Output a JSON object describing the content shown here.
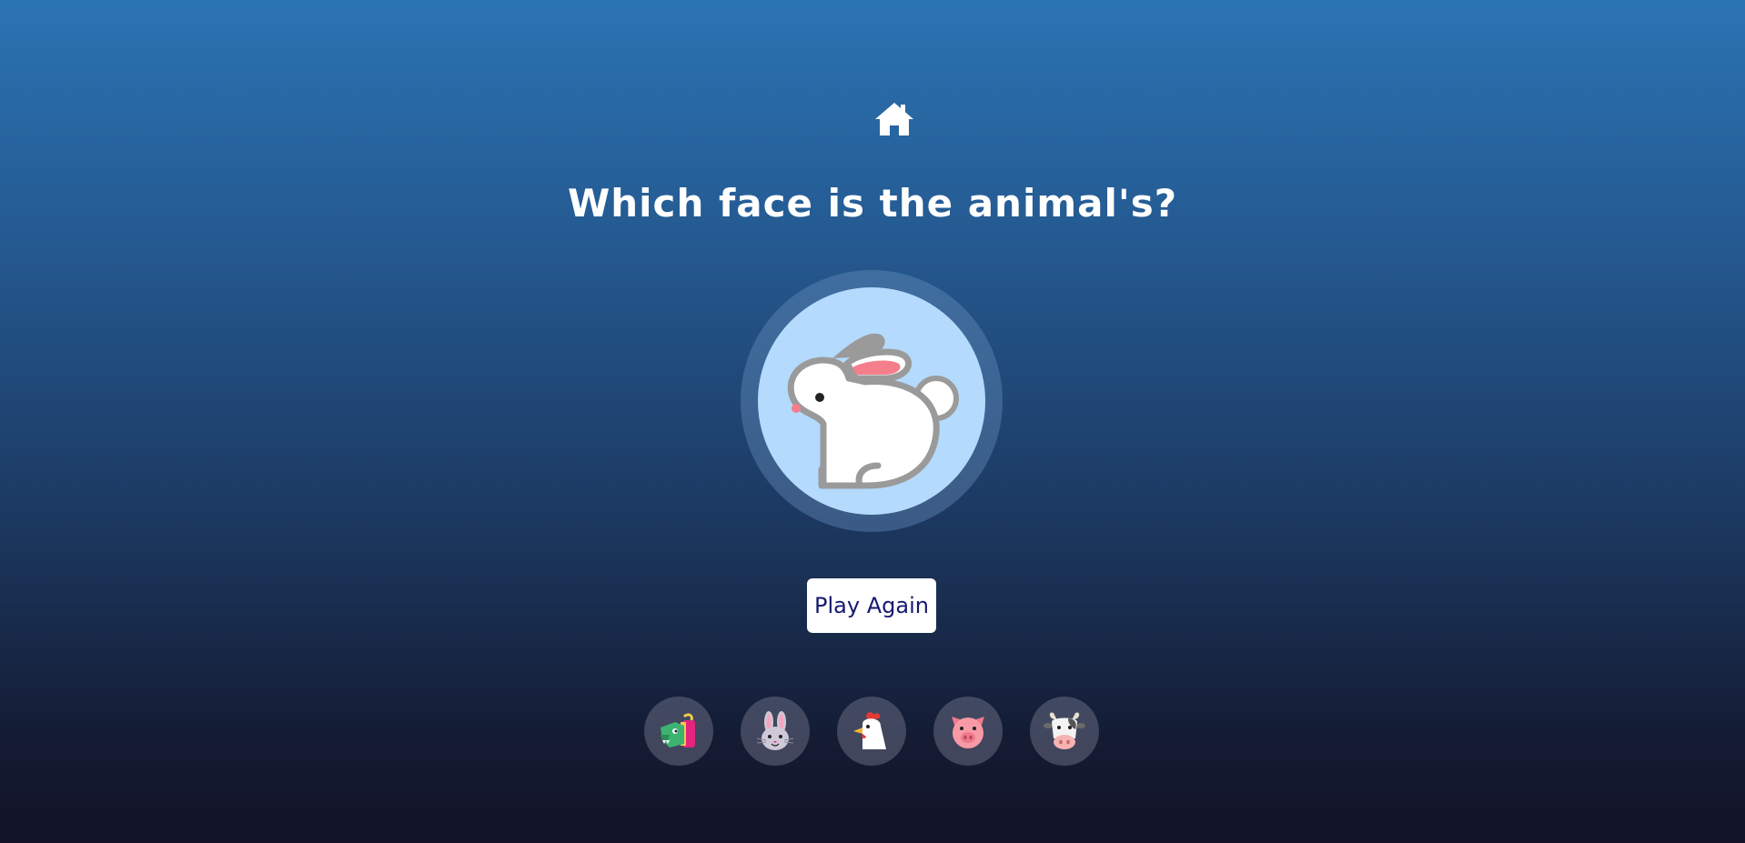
{
  "header": {
    "home_icon": "home-icon"
  },
  "question": {
    "title": "Which face is the animal's?"
  },
  "target": {
    "animal": "rabbit",
    "icon": "rabbit-icon",
    "background_color": "#b4dafd"
  },
  "actions": {
    "play_again_label": "Play Again"
  },
  "choices": [
    {
      "animal": "dragon",
      "icon": "dragon-face-icon"
    },
    {
      "animal": "rabbit",
      "icon": "rabbit-face-icon"
    },
    {
      "animal": "chicken",
      "icon": "chicken-icon"
    },
    {
      "animal": "pig",
      "icon": "pig-face-icon"
    },
    {
      "animal": "cow",
      "icon": "cow-face-icon"
    }
  ],
  "colors": {
    "text": "#ffffff",
    "button_text": "#151a6e",
    "gradient_top": "#2b74b3",
    "gradient_bottom": "#121326"
  }
}
